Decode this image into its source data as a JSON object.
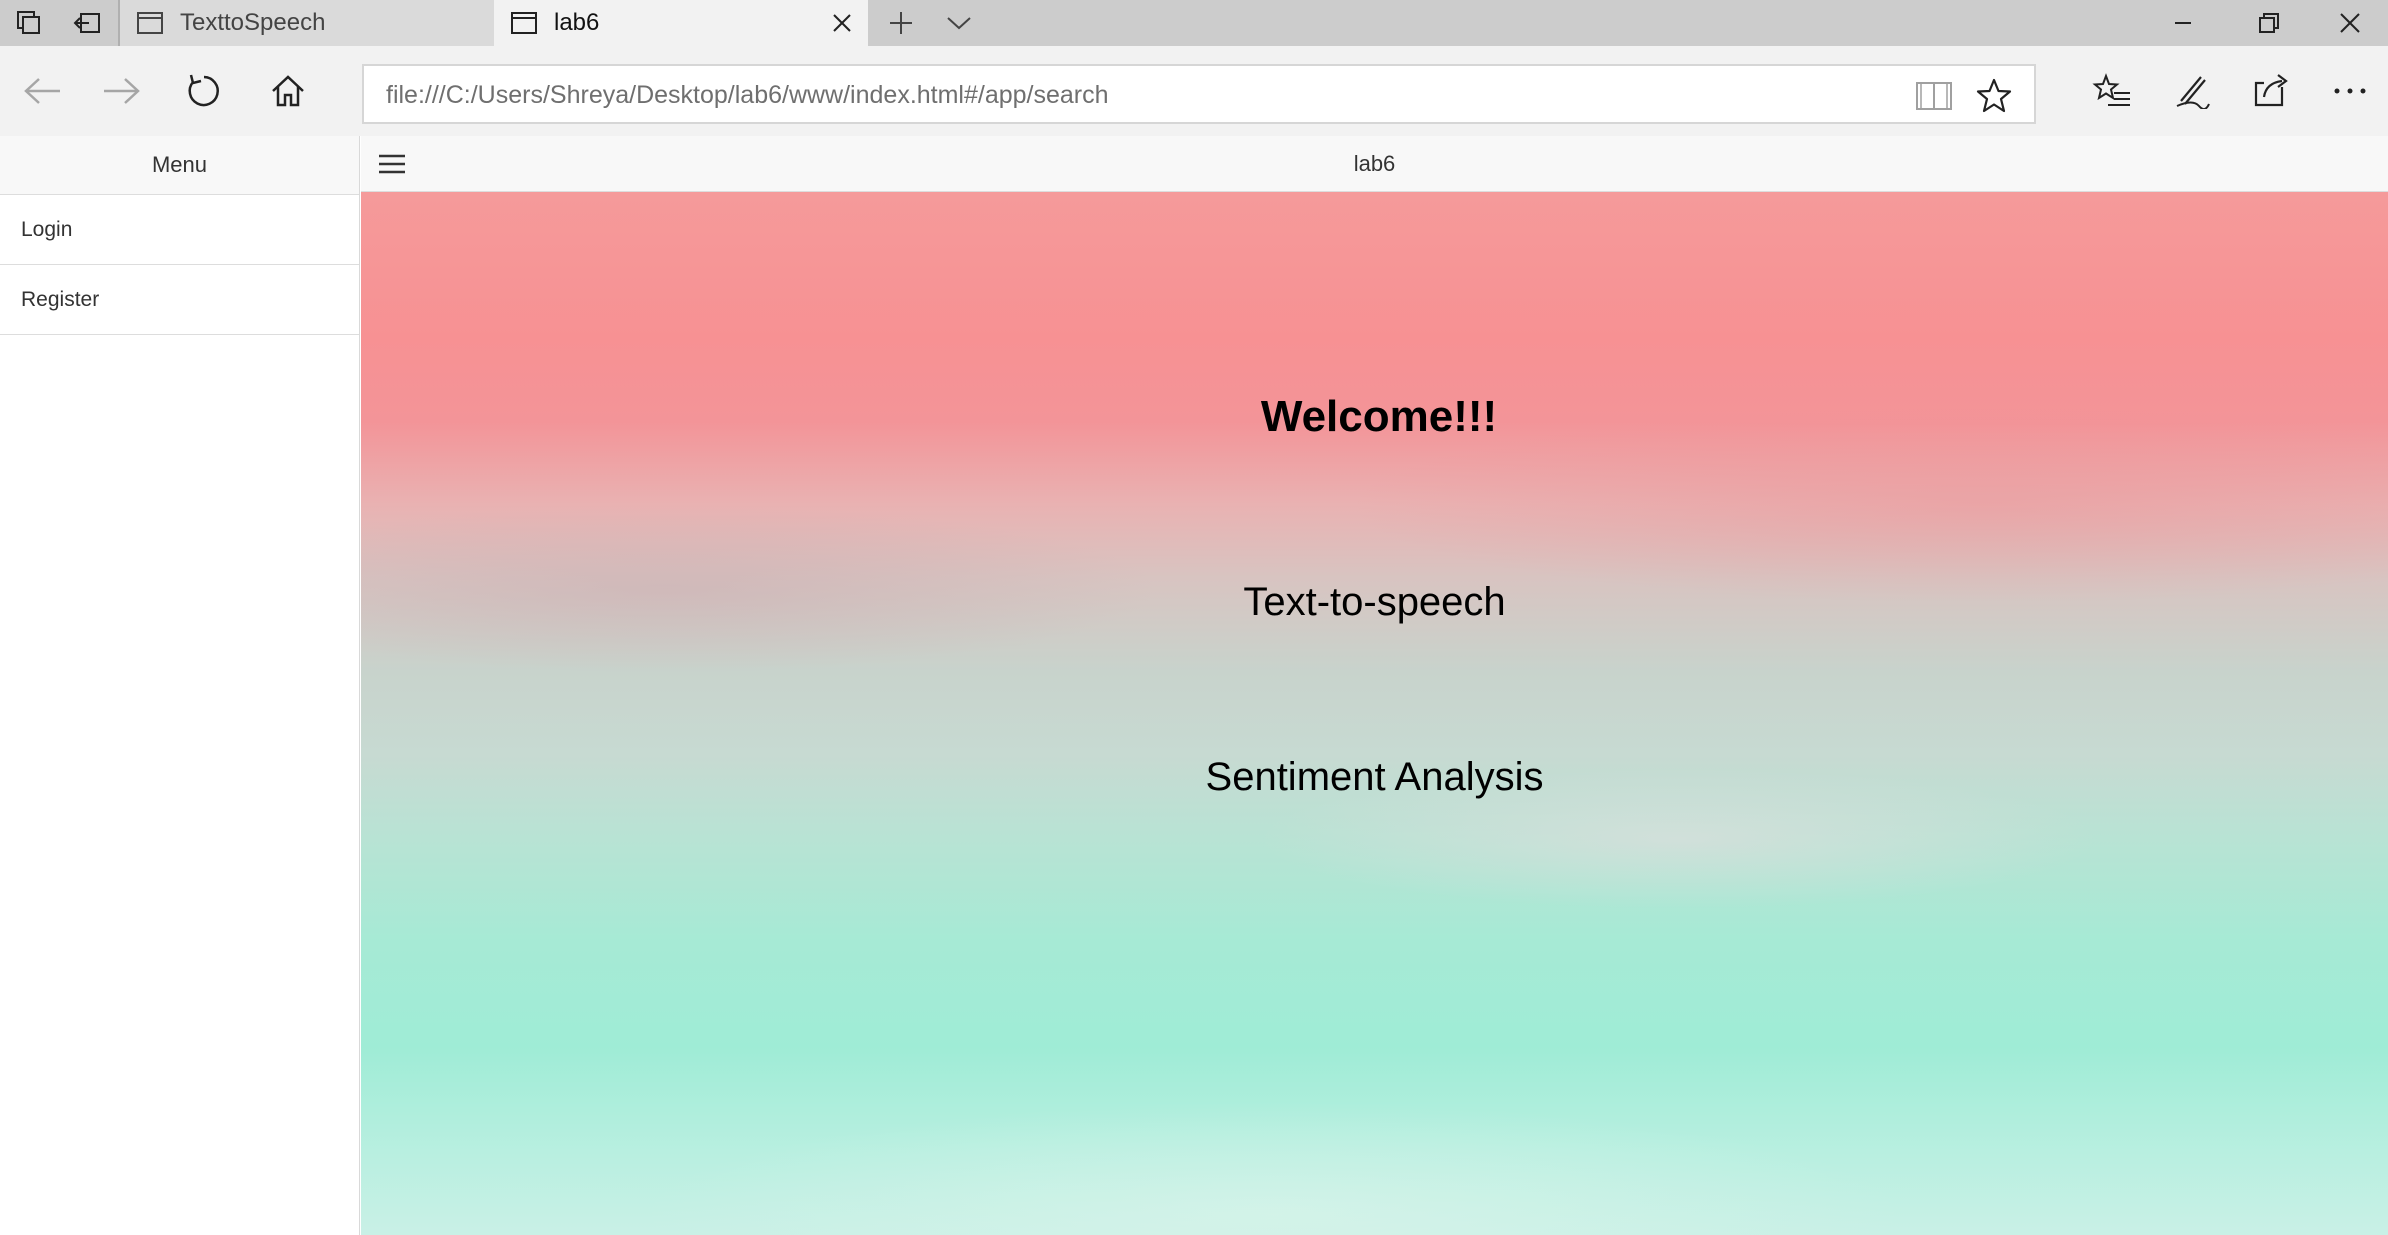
{
  "browser": {
    "tabs": [
      {
        "title": "TexttoSpeech",
        "active": false
      },
      {
        "title": "lab6",
        "active": true
      }
    ],
    "address_url": "file:///C:/Users/Shreya/Desktop/lab6/www/index.html#/app/search"
  },
  "sidebar": {
    "title": "Menu",
    "items": [
      {
        "label": "Login"
      },
      {
        "label": "Register"
      }
    ]
  },
  "header": {
    "title": "lab6"
  },
  "main": {
    "welcome": "Welcome!!!",
    "links": [
      {
        "label": "Text-to-speech"
      },
      {
        "label": "Sentiment Analysis"
      }
    ]
  },
  "colors": {
    "tabstrip": "#cccccc",
    "toolbar": "#f2f2f2",
    "background_top": "#f79193",
    "background_bottom": "#9fecd6"
  }
}
